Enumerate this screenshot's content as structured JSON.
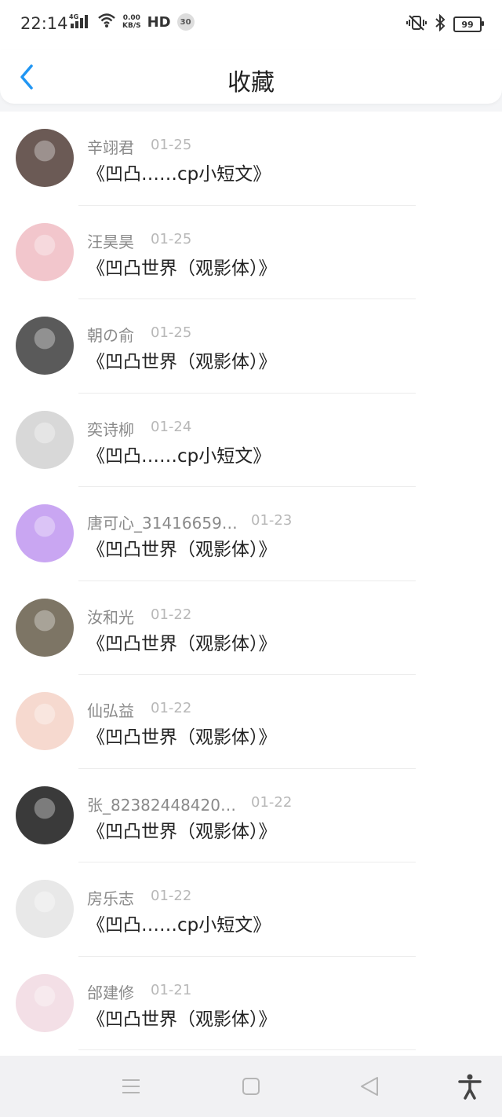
{
  "status_bar": {
    "time": "22:14",
    "network_type": "4G",
    "speed_value": "0.00",
    "speed_unit": "KB/S",
    "hd": "HD",
    "notification_count": "30",
    "battery": "99"
  },
  "header": {
    "title": "收藏"
  },
  "favorites": [
    {
      "name": "辛翊君",
      "date": "01-25",
      "title": "《凹凸……cp小短文》",
      "avatar_color": "#6b5a55"
    },
    {
      "name": "汪昊昊",
      "date": "01-25",
      "title": "《凹凸世界（观影体）》",
      "avatar_color": "#f2c6cc"
    },
    {
      "name": "朝の俞",
      "date": "01-25",
      "title": "《凹凸世界（观影体）》",
      "avatar_color": "#5a5a5a"
    },
    {
      "name": "奕诗柳",
      "date": "01-24",
      "title": "《凹凸……cp小短文》",
      "avatar_color": "#d8d8d8"
    },
    {
      "name": "唐可心_31416659…",
      "date": "01-23",
      "title": "《凹凸世界（观影体）》",
      "avatar_color": "#c9a6f2"
    },
    {
      "name": "汝和光",
      "date": "01-22",
      "title": "《凹凸世界（观影体）》",
      "avatar_color": "#7d7565"
    },
    {
      "name": "仙弘益",
      "date": "01-22",
      "title": "《凹凸世界（观影体）》",
      "avatar_color": "#f6d9cf"
    },
    {
      "name": "张_82382448420…",
      "date": "01-22",
      "title": "《凹凸世界（观影体）》",
      "avatar_color": "#3a3a3a"
    },
    {
      "name": "房乐志",
      "date": "01-22",
      "title": "《凹凸……cp小短文》",
      "avatar_color": "#e8e8e8"
    },
    {
      "name": "邰建修",
      "date": "01-21",
      "title": "《凹凸世界（观影体）》",
      "avatar_color": "#f3dfe6"
    }
  ],
  "navigation": {
    "icons": [
      "menu-icon",
      "home-square-icon",
      "back-triangle-icon",
      "accessibility-icon"
    ]
  },
  "colors": {
    "accent": "#2196f3",
    "name": "#8a8a8a",
    "date": "#b8b8b8"
  }
}
